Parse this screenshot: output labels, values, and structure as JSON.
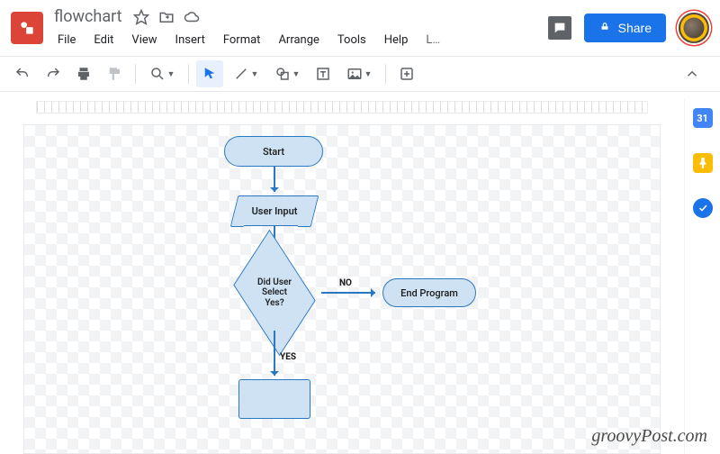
{
  "app": {
    "title": "flowchart",
    "docIcon": "drawings-doc-icon"
  },
  "titleActions": {
    "star": "star-icon",
    "move": "move-to-folder-icon",
    "cloud": "cloud-status-icon"
  },
  "menu": {
    "file": "File",
    "edit": "Edit",
    "view": "View",
    "insert": "Insert",
    "format": "Format",
    "arrange": "Arrange",
    "tools": "Tools",
    "help": "Help",
    "more": "L…"
  },
  "headerRight": {
    "comments": "comments-icon",
    "shareLabel": "Share",
    "avatar": "account-avatar"
  },
  "toolbar": {
    "undo": "undo-icon",
    "redo": "redo-icon",
    "print": "print-icon",
    "paintFormat": "paint-format-icon",
    "zoom": "zoom-icon",
    "select": "select-tool-icon",
    "line": "line-tool-icon",
    "shape": "shape-tool-icon",
    "textbox": "textbox-tool-icon",
    "image": "image-tool-icon",
    "insert": "insert-more-icon",
    "collapse": "collapse-toolbar-icon"
  },
  "rail": {
    "calendar": "31",
    "keep": "keep-icon",
    "tasks": "tasks-icon"
  },
  "flowchart": {
    "start": "Start",
    "userInput": "User Input",
    "decision": "Did User\nSelect\nYes?",
    "no": "NO",
    "yes": "YES",
    "endProgram": "End Program"
  },
  "watermark": "groovyPost.com"
}
